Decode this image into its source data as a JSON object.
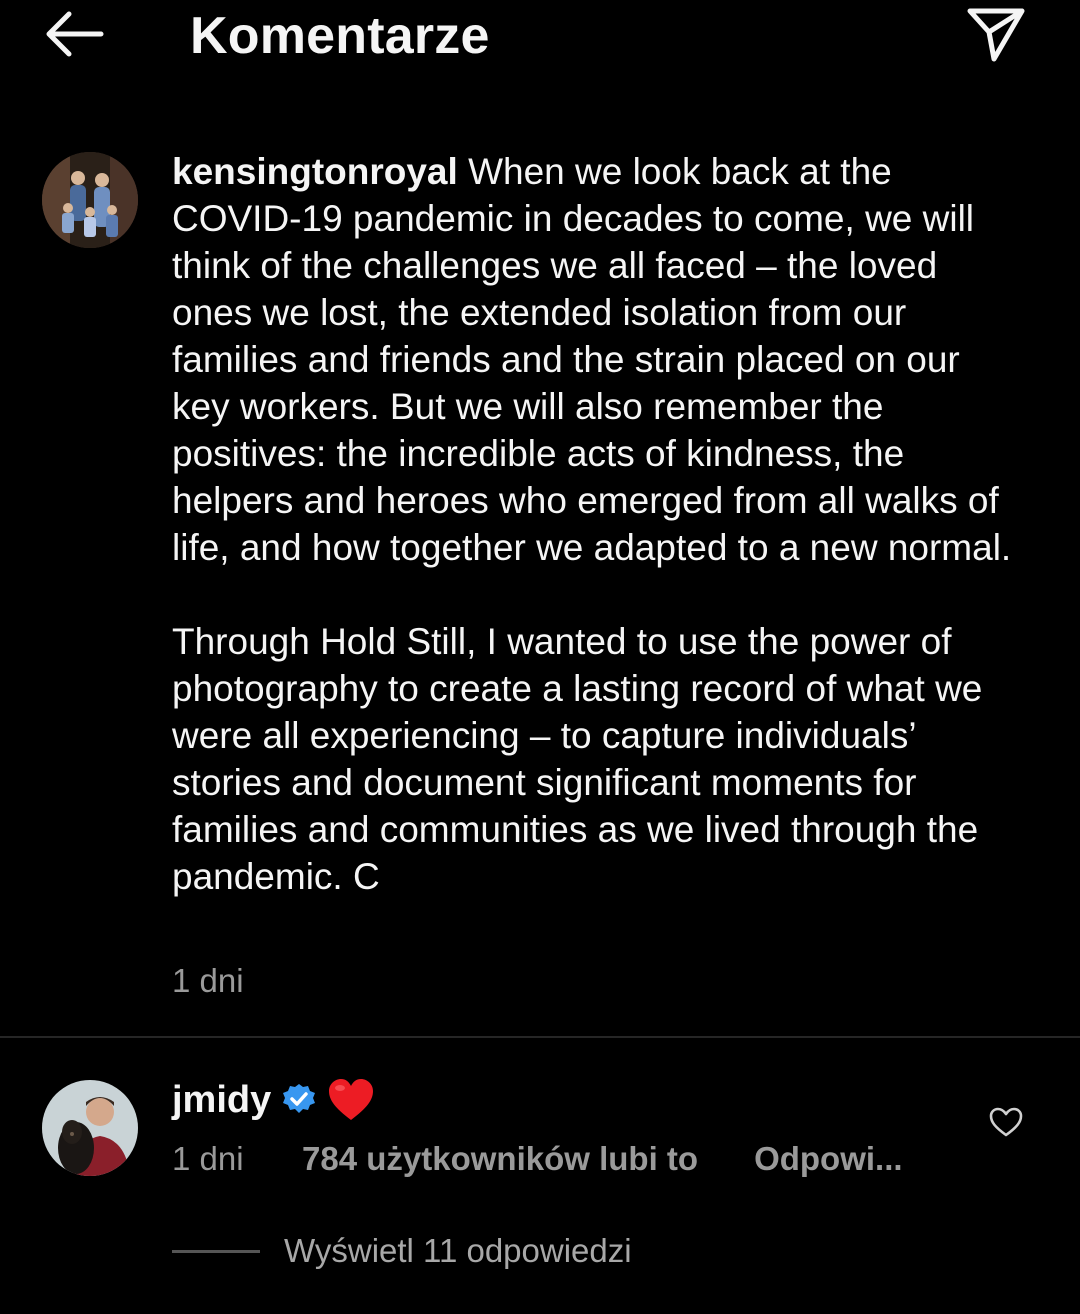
{
  "header": {
    "back_icon": "arrow-left-icon",
    "title": "Komentarze",
    "send_icon": "paper-plane-icon"
  },
  "caption": {
    "avatar_icon": "family-photo-avatar",
    "username": "kensingtonroyal",
    "paragraph1": "When we look back at the COVID-19 pandemic in decades to come, we will think of the challenges we all faced – the loved ones we lost, the extended isolation from our families and friends and the strain placed on our key workers. But we will also remember the positives: the incredible acts of kindness, the helpers and heroes who emerged from all walks of life, and how together we adapted to a new normal.",
    "paragraph2": "Through Hold Still, I wanted to use the power of photography to create a lasting record of what we were all experiencing – to capture individuals’ stories and document significant moments for families and communities as we lived through the pandemic. C",
    "time": "1 dni"
  },
  "comment": {
    "avatar_icon": "man-with-dog-avatar",
    "username": "jmidy",
    "verified_icon": "verified-badge-icon",
    "text_icon": "red-heart-emoji",
    "time": "1 dni",
    "likes": "784 użytkowników lubi to",
    "reply": "Odpowi...",
    "like_icon": "heart-outline-icon",
    "view_replies": "Wyświetl 11 odpowiedzi"
  },
  "colors": {
    "background": "#000000",
    "text": "#f5f5f5",
    "secondary_text": "#9a9a9a",
    "verified_blue": "#3897f0",
    "heart_red": "#ed1c24"
  }
}
